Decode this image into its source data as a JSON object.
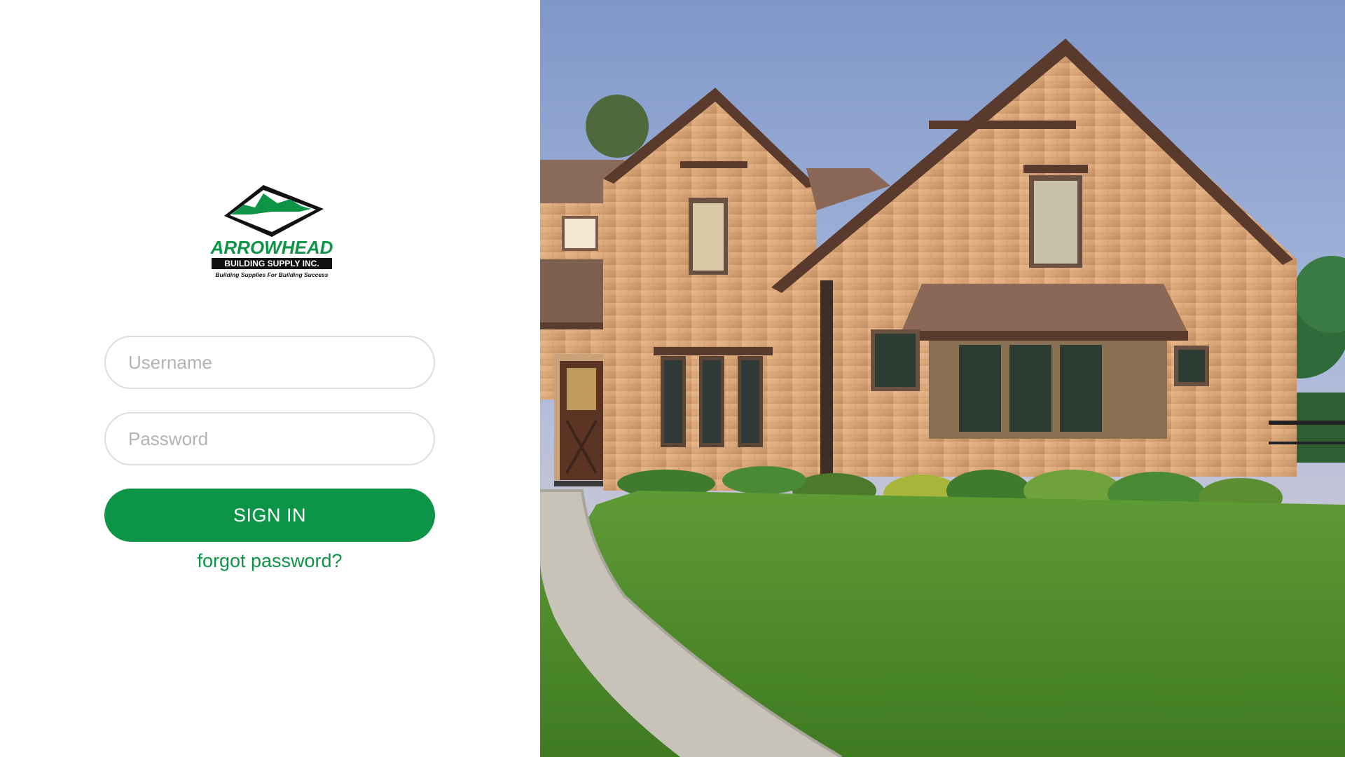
{
  "brand": {
    "name": "ARROWHEAD",
    "subtitle": "BUILDING SUPPLY INC.",
    "tagline": "Building Supplies For Building Success",
    "color": "#0c9547"
  },
  "login": {
    "username_placeholder": "Username",
    "password_placeholder": "Password",
    "signin_label": "SIGN IN",
    "forgot_label": "forgot password?"
  },
  "hero": {
    "image": "house-photo"
  }
}
